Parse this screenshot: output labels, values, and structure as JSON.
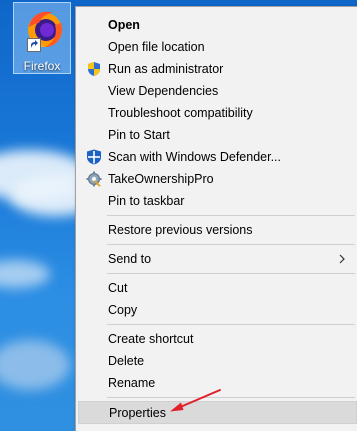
{
  "desktop": {
    "shortcut": {
      "label": "Firefox",
      "icon": "firefox-icon"
    }
  },
  "context_menu": {
    "items": [
      {
        "label": "Open",
        "bold": true,
        "icon": null
      },
      {
        "label": "Open file location",
        "icon": null
      },
      {
        "label": "Run as administrator",
        "icon": "uac-shield-icon"
      },
      {
        "label": "View Dependencies",
        "icon": null
      },
      {
        "label": "Troubleshoot compatibility",
        "icon": null
      },
      {
        "label": "Pin to Start",
        "icon": null
      },
      {
        "label": "Scan with Windows Defender...",
        "icon": "windows-defender-icon"
      },
      {
        "label": "TakeOwnershipPro",
        "icon": "take-ownership-icon"
      },
      {
        "label": "Pin to taskbar",
        "icon": null
      },
      {
        "label": "Restore previous versions",
        "icon": null
      },
      {
        "label": "Send to",
        "icon": null,
        "submenu": true
      },
      {
        "label": "Cut",
        "icon": null
      },
      {
        "label": "Copy",
        "icon": null
      },
      {
        "label": "Create shortcut",
        "icon": null
      },
      {
        "label": "Delete",
        "icon": null
      },
      {
        "label": "Rename",
        "icon": null
      },
      {
        "label": "Properties",
        "icon": null,
        "highlighted": true
      }
    ],
    "highlight_color": "#dadada",
    "annotation_arrow_color": "#e0202a"
  }
}
